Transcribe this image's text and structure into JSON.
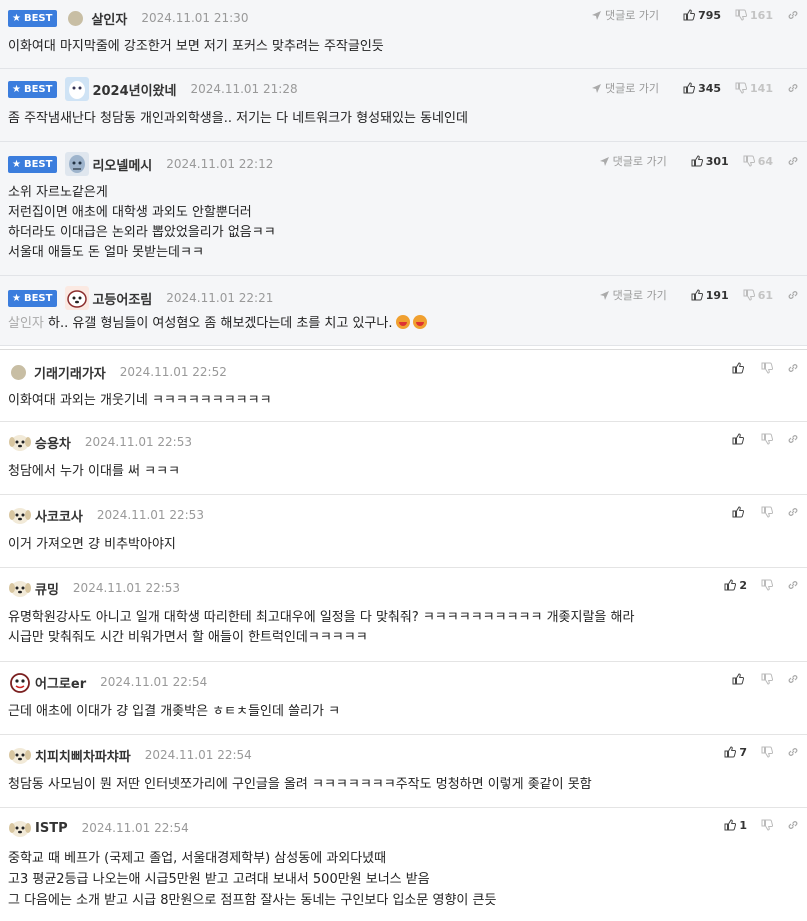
{
  "ui": {
    "best_label": "BEST",
    "reply_label": "댓글로 가기"
  },
  "colors": {
    "badge": "#3b7ddd",
    "best_bg": "#f5f6f8"
  },
  "best_comments": [
    {
      "nick": "살인자",
      "time": "2024.11.01 21:30",
      "likes": "795",
      "dislikes": "161",
      "avatar": "dot-avatar",
      "lines": [
        "이화여대 마지막줄에 강조한거 보면 저기 포커스 맞추려는 주작글인듯"
      ]
    },
    {
      "nick": "2024년이왔네",
      "time": "2024.11.01 21:28",
      "likes": "345",
      "dislikes": "141",
      "avatar": "ghost-avatar",
      "lines": [
        "좀 주작냄새난다 청담동 개인과외학생을.. 저기는 다 네트워크가 형성돼있는 동네인데"
      ]
    },
    {
      "nick": "리오넬메시",
      "time": "2024.11.01 22:12",
      "likes": "301",
      "dislikes": "64",
      "avatar": "messi-avatar",
      "lines": [
        "소위 자르노같은게",
        "저런집이면 애초에 대학생 과외도 안할뿐더러",
        "하더라도 이대급은 논외라 뽑았었을리가 없음ㅋㅋ",
        "서울대 애들도 돈 얼마 못받는데ㅋㅋ"
      ]
    },
    {
      "nick": "고등어조림",
      "time": "2024.11.01 22:21",
      "likes": "191",
      "dislikes": "61",
      "avatar": "dog-avatar",
      "mention": "살인자",
      "lines": [
        "하.. 유갤 형님들이 여성혐오 좀 해보겠다는데 초를 치고 있구나."
      ]
    }
  ],
  "comments": [
    {
      "nick": "기래기래가자",
      "time": "2024.11.01 22:52",
      "likes": "",
      "avatar": "dot-avatar",
      "lines": [
        "이화여대 과외는 개웃기네 ㅋㅋㅋㅋㅋㅋㅋㅋㅋㅋ"
      ]
    },
    {
      "nick": "승용차",
      "time": "2024.11.01 22:53",
      "likes": "",
      "avatar": "puppy-avatar",
      "lines": [
        "청담에서 누가 이대를 써 ㅋㅋㅋ"
      ]
    },
    {
      "nick": "사코코사",
      "time": "2024.11.01 22:53",
      "likes": "",
      "avatar": "puppy-avatar",
      "lines": [
        "이거 가져오면 걍 비추박아야지"
      ]
    },
    {
      "nick": "큐밍",
      "time": "2024.11.01 22:53",
      "likes": "2",
      "avatar": "puppy-avatar",
      "lines": [
        "유명학원강사도 아니고 일개 대학생 따리한테 최고대우에 일정을 다 맞춰줘? ㅋㅋㅋㅋㅋㅋㅋㅋㅋㅋ 개좆지랄을 해라",
        "시급만 맞춰줘도 시간 비워가면서 할 애들이 한트럭인데ㅋㅋㅋㅋㅋ"
      ]
    },
    {
      "nick": "어그로er",
      "time": "2024.11.01 22:54",
      "likes": "",
      "avatar": "monster-avatar",
      "lines": [
        "근데 애초에 이대가 걍 입결 개좆박은 ㅎㅌㅊ들인데 쓸리가 ㅋ"
      ]
    },
    {
      "nick": "치피치삐차파챠파",
      "time": "2024.11.01 22:54",
      "likes": "7",
      "avatar": "puppy-avatar",
      "lines": [
        "청담동 사모님이 뭔 저딴 인터넷쪼가리에 구인글을 올려 ㅋㅋㅋㅋㅋㅋㅋ주작도 멍청하면 이렇게 좆같이 못함"
      ]
    },
    {
      "nick": "ISTP",
      "time": "2024.11.01 22:54",
      "likes": "1",
      "avatar": "puppy-avatar",
      "lines": [
        "중학교 때 베프가 (국제고 졸업, 서울대경제학부) 삼성동에 과외다녔때",
        "고3 평균2등급 나오는애 시급5만원 받고 고려대 보내서 500만원 보너스 받음",
        "그 다음에는 소개 받고 시급 8만원으로 점프함 잘사는 동네는 구인보다 입소문 영향이 큰듯"
      ]
    }
  ]
}
